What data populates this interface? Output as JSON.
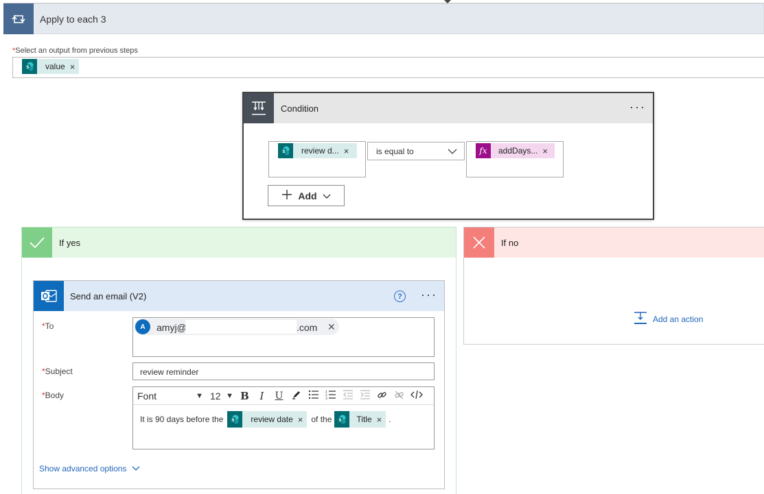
{
  "apply_to_each": {
    "title": "Apply to each 3",
    "select_label": "Select an output from previous steps",
    "required_mark": "*",
    "token_value": "value"
  },
  "condition": {
    "title": "Condition",
    "more_glyph": "···",
    "left_token": "review d...",
    "operator": "is equal to",
    "right_token": "addDays...",
    "fx_glyph": "fx",
    "add_label": "Add"
  },
  "if_yes": {
    "title": "If yes"
  },
  "if_no": {
    "title": "If no",
    "add_action_label": "Add an action"
  },
  "email": {
    "title": "Send an email (V2)",
    "help_glyph": "?",
    "more_glyph": "···",
    "to_label": "To",
    "to_avatar_letter": "A",
    "to_prefix": "amyj@",
    "to_suffix": ".com",
    "subject_label": "Subject",
    "subject_value": "review reminder",
    "body_label": "Body",
    "font_name": "Font",
    "font_size": "12",
    "body_text_1": "It is 90 days before the",
    "body_token_1": "review date",
    "body_text_2": "of the",
    "body_token_2": "Title",
    "body_text_3": ".",
    "advanced_label": "Show advanced options"
  },
  "colors": {
    "sharepoint_teal": "#036c70",
    "expression_purple": "#9c0e8a",
    "outlook_blue": "#0f6cbd",
    "yes_green": "#7fcf89",
    "no_red": "#f47f7a",
    "loop_blue": "#486991",
    "link_blue": "#2266bb"
  }
}
